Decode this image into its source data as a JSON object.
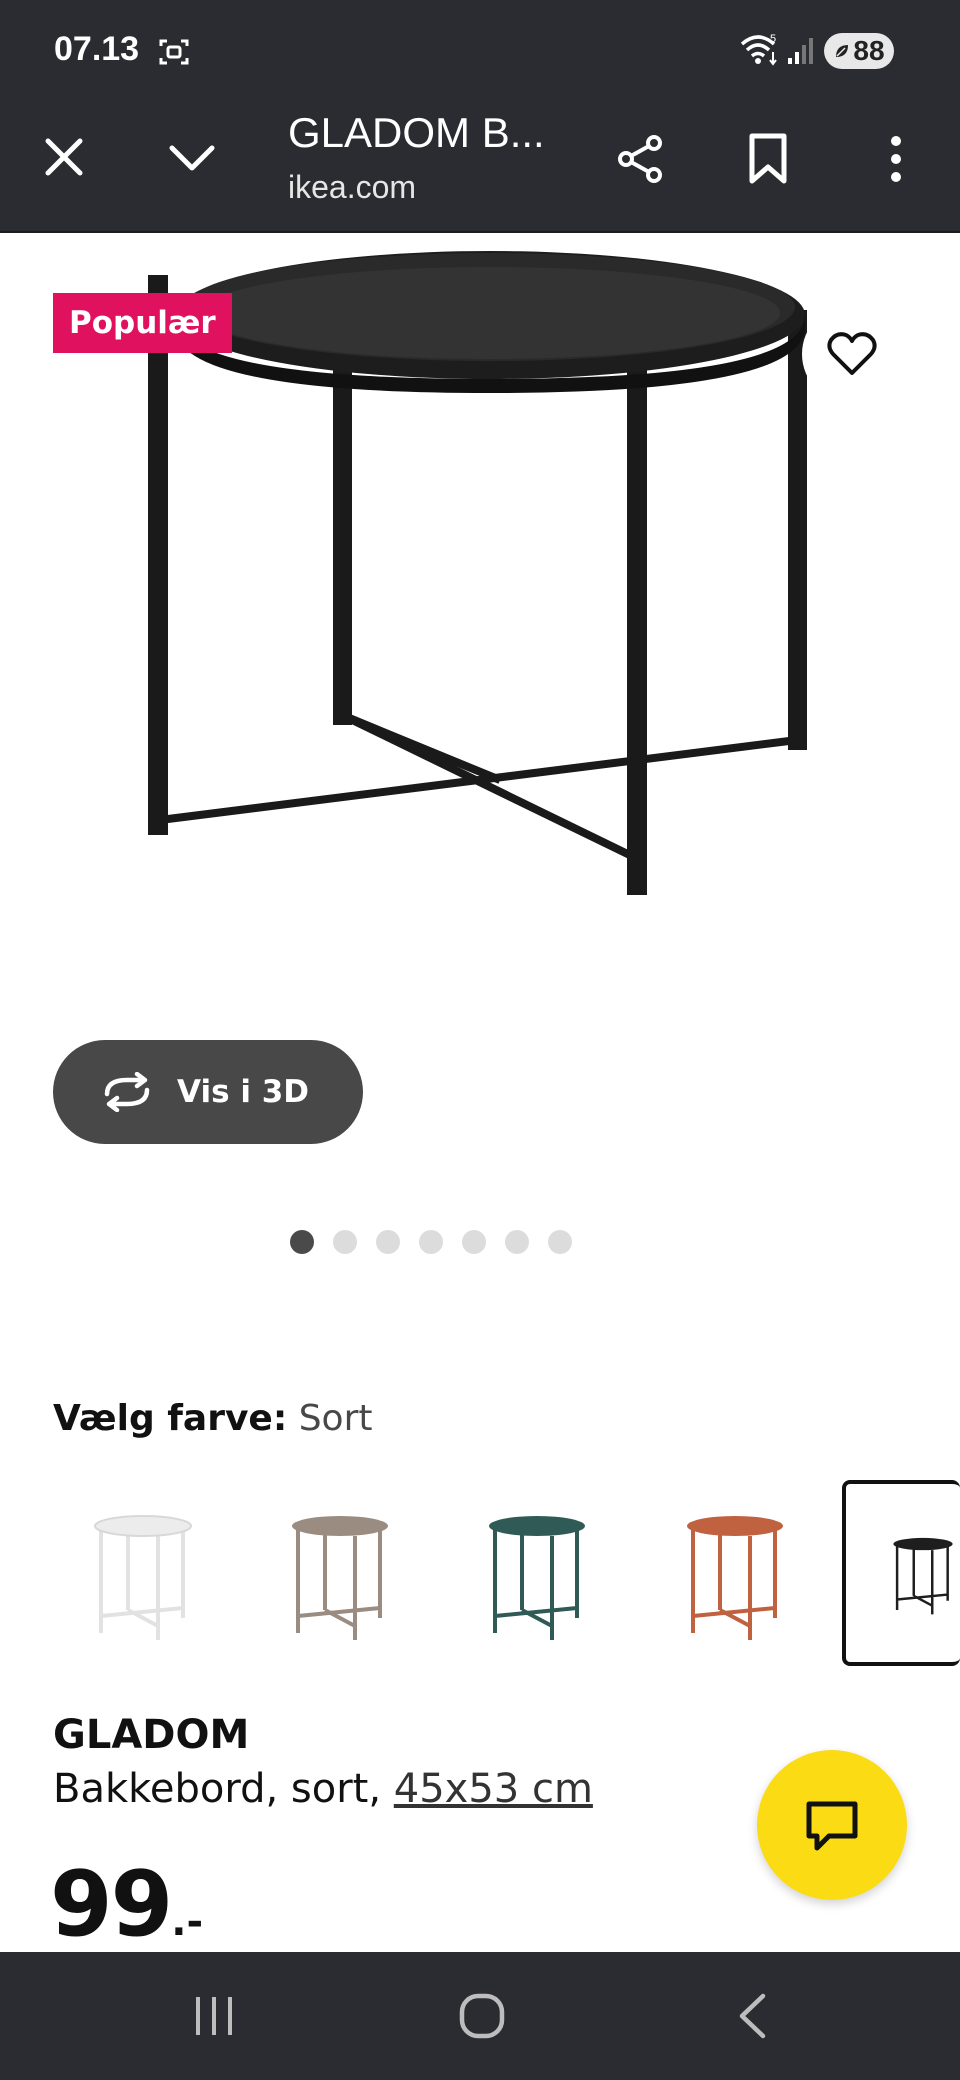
{
  "status_bar": {
    "time": "07.13",
    "wifi_badge": "5",
    "battery": "88",
    "icons": [
      "screenshot-icon",
      "wifi-icon",
      "signal-icon",
      "battery-saver-leaf-icon"
    ]
  },
  "browser": {
    "title": "GLADOM B...",
    "url": "ikea.com",
    "icons": [
      "close-icon",
      "chevron-down-icon",
      "share-icon",
      "bookmark-icon",
      "more-vertical-icon"
    ]
  },
  "product": {
    "badge": "Populær",
    "view_3d_label": "Vis i 3D",
    "image_count": 7,
    "active_image": 1,
    "colour_label": "Vælg farve:",
    "colour_value": "Sort",
    "colours": [
      {
        "name": "white",
        "hex": "#ececec"
      },
      {
        "name": "beige",
        "hex": "#9a8c80"
      },
      {
        "name": "green",
        "hex": "#2f5a56"
      },
      {
        "name": "orange",
        "hex": "#c0613f"
      },
      {
        "name": "black",
        "hex": "#1e1e1e"
      }
    ],
    "selected_colour": "black",
    "name": "GLADOM",
    "description": "Bakkebord, sort,",
    "size": "45x53 cm",
    "price": "99",
    "price_suffix": ".-"
  },
  "colors": {
    "system_bar": "#2b2c31",
    "badge_bg": "#e0115f",
    "chat_button": "#fadb14",
    "view_3d_bg": "#484848"
  },
  "nav_bar": {
    "icons": [
      "recent-apps-icon",
      "home-icon",
      "back-icon"
    ]
  }
}
